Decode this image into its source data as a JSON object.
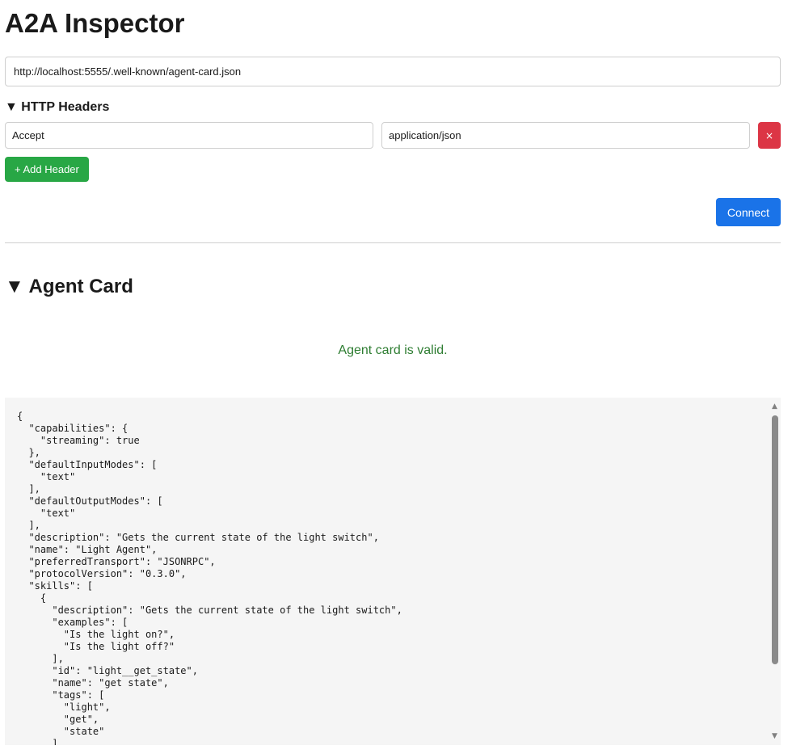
{
  "app": {
    "title": "A2A Inspector"
  },
  "connection": {
    "url": "http://localhost:5555/.well-known/agent-card.json",
    "connect_label": "Connect"
  },
  "headers_section": {
    "toggle_label": "▼ HTTP Headers",
    "rows": [
      {
        "key": "Accept",
        "value": "application/json",
        "remove_label": "×"
      }
    ],
    "add_label": "+ Add Header"
  },
  "agent_card": {
    "toggle_label": "▼ Agent Card",
    "status_text": "Agent card is valid.",
    "status_color": "#2e7d32",
    "json_lines": [
      "{",
      "  \"capabilities\": {",
      "    \"streaming\": true",
      "  },",
      "  \"defaultInputModes\": [",
      "    \"text\"",
      "  ],",
      "  \"defaultOutputModes\": [",
      "    \"text\"",
      "  ],",
      "  \"description\": \"Gets the current state of the light switch\",",
      "  \"name\": \"Light Agent\",",
      "  \"preferredTransport\": \"JSONRPC\",",
      "  \"protocolVersion\": \"0.3.0\",",
      "  \"skills\": [",
      "    {",
      "      \"description\": \"Gets the current state of the light switch\",",
      "      \"examples\": [",
      "        \"Is the light on?\",",
      "        \"Is the light off?\"",
      "      ],",
      "      \"id\": \"light__get_state\",",
      "      \"name\": \"get state\",",
      "      \"tags\": [",
      "        \"light\",",
      "        \"get\",",
      "        \"state\"",
      "      ]"
    ]
  },
  "scrollbar": {
    "up_icon": "▲",
    "down_icon": "▼"
  },
  "colors": {
    "connect": "#1a73e8",
    "add": "#28a745",
    "remove": "#dc3545",
    "valid": "#2e7d32",
    "json_background": "#f5f5f5"
  }
}
